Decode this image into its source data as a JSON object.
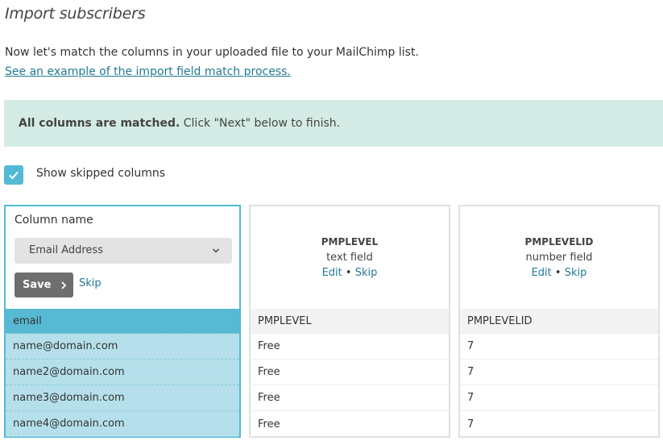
{
  "page": {
    "title": "Import subscribers",
    "intro": "Now let's match the columns in your uploaded file to your MailChimp list.",
    "intro_link": "See an example of the import field match process."
  },
  "notice": {
    "bold": "All columns are matched.",
    "text": " Click \"Next\" below to finish.",
    "bg_color": "#d5ebe5"
  },
  "skipped": {
    "label": "Show skipped columns",
    "checked": true
  },
  "accent_color": "#52bad5",
  "link_color": "#227a93",
  "columns": [
    {
      "editing": true,
      "label": "Column name",
      "select_value": "Email Address",
      "save_label": "Save",
      "skip_label": "Skip",
      "rows": [
        "email",
        "name@domain.com",
        "name2@domain.com",
        "name3@domain.com",
        "name4@domain.com"
      ]
    },
    {
      "name": "PMPLEVEL",
      "type": "text field",
      "edit_label": "Edit",
      "skip_label": "Skip",
      "rows": [
        "PMPLEVEL",
        "Free",
        "Free",
        "Free",
        "Free"
      ]
    },
    {
      "name": "PMPLEVELID",
      "type": "number field",
      "edit_label": "Edit",
      "skip_label": "Skip",
      "rows": [
        "PMPLEVELID",
        "7",
        "7",
        "7",
        "7"
      ]
    }
  ]
}
